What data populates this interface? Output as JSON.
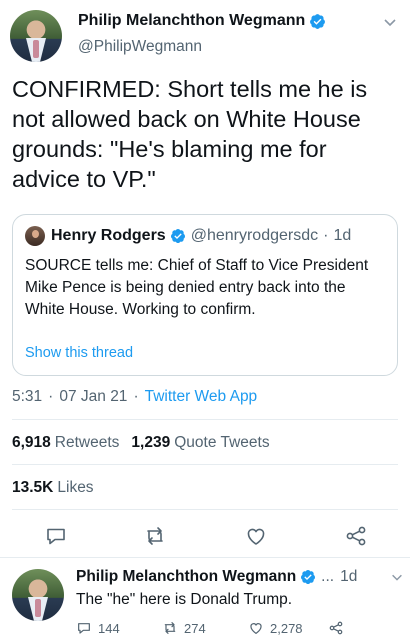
{
  "tweet": {
    "author_name": "Philip Melanchthon Wegmann",
    "author_handle": "@PhilipWegmann",
    "text": "CONFIRMED: Short tells me he is\nnot allowed back on White House\ngrounds: \"He's blaming me for\nadvice to VP.\"",
    "time": "5:31",
    "date": "07 Jan 21",
    "app": "Twitter Web App",
    "retweets": "6,918",
    "retweets_label": "Retweets",
    "quote_tweets": "1,239",
    "quote_tweets_label": "Quote Tweets",
    "likes": "13.5K",
    "likes_label": "Likes"
  },
  "quoted": {
    "author_name": "Henry Rodgers",
    "author_handle": "@henryrodgersdc",
    "time": "1d",
    "text": "SOURCE tells me: Chief of Staff to Vice President Mike Pence is being denied entry back into the White House. Working to confirm.",
    "show_thread": "Show this thread"
  },
  "reply": {
    "author_name": "Philip Melanchthon Wegmann",
    "author_handle": "...",
    "time": "1d",
    "text": "The \"he\" here is Donald Trump.",
    "replies": "144",
    "retweets": "274",
    "likes": "2,278"
  },
  "separators": {
    "dot": "·"
  },
  "colors": {
    "accent": "#1d9bf0",
    "secondary_text": "#536471",
    "border": "#cfd9de"
  },
  "icons": [
    "verified-badge-icon",
    "chevron-down-icon",
    "reply-icon",
    "retweet-icon",
    "like-icon",
    "share-icon"
  ]
}
